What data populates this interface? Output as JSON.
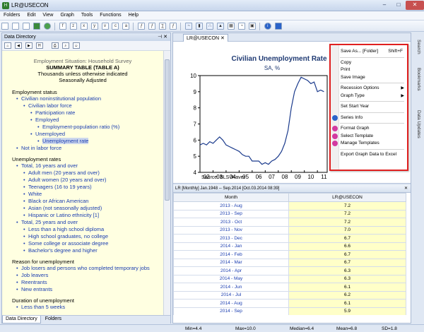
{
  "window": {
    "title": "LR@USECON"
  },
  "menu": [
    "Folders",
    "Edit",
    "View",
    "Graph",
    "Tools",
    "Functions",
    "Help"
  ],
  "left_panel": {
    "header": "Data Directory",
    "doc": {
      "subtitle": "Employment Situation: Household Survey",
      "title": "SUMMARY TABLE (TABLE A)",
      "line1": "Thousands unless otherwise indicated",
      "line2": "Seasonally Adjusted"
    },
    "sections": [
      {
        "heading": "Employment status",
        "items": [
          {
            "label": "Civilian noninstitutional population",
            "level": 1
          },
          {
            "label": "Civilian labor force",
            "level": 2
          },
          {
            "label": "Participation rate",
            "level": 3
          },
          {
            "label": "Employed",
            "level": 3
          },
          {
            "label": "Employment-population ratio (%)",
            "level": 4
          },
          {
            "label": "Unemployed",
            "level": 3
          },
          {
            "label": "Unemployment rate",
            "level": 4,
            "selected": true
          },
          {
            "label": "Not in labor force",
            "level": 1
          }
        ]
      },
      {
        "heading": "Unemployment rates",
        "items": [
          {
            "label": "Total, 16 years and over",
            "level": 1
          },
          {
            "label": "Adult men (20 years and over)",
            "level": 2
          },
          {
            "label": "Adult women (20 years and over)",
            "level": 2
          },
          {
            "label": "Teenagers (16 to 19 years)",
            "level": 2
          },
          {
            "label": "White",
            "level": 2
          },
          {
            "label": "Black or African American",
            "level": 2
          },
          {
            "label": "Asian (not seasonally adjusted)",
            "level": 2
          },
          {
            "label": "Hispanic or Latino ethnicity [1]",
            "level": 2
          },
          {
            "label": "Total, 25 years and over",
            "level": 1
          },
          {
            "label": "Less than a high school diploma",
            "level": 2
          },
          {
            "label": "High school graduates, no college",
            "level": 2
          },
          {
            "label": "Some college or associate degree",
            "level": 2
          },
          {
            "label": "Bachelor's degree and higher",
            "level": 2
          }
        ]
      },
      {
        "heading": "Reason for unemployment",
        "items": [
          {
            "label": "Job losers and persons who completed temporary jobs",
            "level": 1
          },
          {
            "label": "Job leavers",
            "level": 1
          },
          {
            "label": "Reentrants",
            "level": 1
          },
          {
            "label": "New entrants",
            "level": 1
          }
        ]
      },
      {
        "heading": "Duration of unemployment",
        "items": [
          {
            "label": "Less than 5 weeks",
            "level": 1
          }
        ]
      }
    ],
    "tabs": [
      "Data Directory",
      "Folders"
    ]
  },
  "doc_tab": {
    "label": "LR@USECON"
  },
  "chart_data": {
    "type": "line",
    "title": "Civilian Unemployment Rate",
    "subtitle": "SA, %",
    "source": "Source:  BLS /Haver",
    "ylim": [
      4,
      10
    ],
    "yticks": [
      4,
      5,
      6,
      7,
      8,
      9,
      10
    ],
    "xticks": [
      "02",
      "03",
      "04",
      "05",
      "06",
      "07",
      "08",
      "09",
      "10",
      "11"
    ],
    "x": [
      2002.0,
      2002.25,
      2002.5,
      2002.75,
      2003.0,
      2003.25,
      2003.5,
      2003.75,
      2004.0,
      2004.25,
      2004.5,
      2004.75,
      2005.0,
      2005.25,
      2005.5,
      2005.75,
      2006.0,
      2006.25,
      2006.5,
      2006.75,
      2007.0,
      2007.25,
      2007.5,
      2007.75,
      2008.0,
      2008.25,
      2008.5,
      2008.75,
      2009.0,
      2009.25,
      2009.5,
      2009.75,
      2010.0,
      2010.25,
      2010.5,
      2010.75,
      2011.0,
      2011.25,
      2011.5
    ],
    "series": [
      {
        "name": "",
        "values": [
          5.7,
          5.8,
          5.7,
          5.9,
          5.8,
          6.0,
          6.2,
          6.0,
          5.7,
          5.6,
          5.5,
          5.4,
          5.3,
          5.1,
          5.0,
          5.0,
          4.7,
          4.7,
          4.7,
          4.5,
          4.6,
          4.5,
          4.7,
          4.8,
          5.0,
          5.3,
          5.8,
          6.6,
          8.0,
          9.0,
          9.5,
          9.9,
          9.8,
          9.7,
          9.5,
          9.6,
          9.0,
          9.1,
          9.0
        ]
      }
    ]
  },
  "grid": {
    "header": "LR    [Monthly]   Jan.1948 -- Sep.2014   [Oct.03.2014 08:39]",
    "col_month": "Month",
    "col_value": "LR@USECON",
    "rows": [
      {
        "month": "2013 - Aug",
        "value": "7.2"
      },
      {
        "month": "2013 - Sep",
        "value": "7.2"
      },
      {
        "month": "2013 - Oct",
        "value": "7.2"
      },
      {
        "month": "2013 - Nov",
        "value": "7.0"
      },
      {
        "month": "2013 - Dec",
        "value": "6.7"
      },
      {
        "month": "2014 - Jan",
        "value": "6.6"
      },
      {
        "month": "2014 - Feb",
        "value": "6.7"
      },
      {
        "month": "2014 - Mar",
        "value": "6.7"
      },
      {
        "month": "2014 - Apr",
        "value": "6.3"
      },
      {
        "month": "2014 - May",
        "value": "6.3"
      },
      {
        "month": "2014 - Jun",
        "value": "6.1"
      },
      {
        "month": "2014 - Jul",
        "value": "6.2"
      },
      {
        "month": "2014 - Aug",
        "value": "6.1"
      },
      {
        "month": "2014 - Sep",
        "value": "5.9"
      }
    ]
  },
  "status": {
    "min": "Min=4.4",
    "max": "Max=10.0",
    "median": "Median=6.4",
    "mean": "Mean=6.8",
    "sd": "SD=1.8"
  },
  "side_tabs": [
    "Search",
    "Bookmarks",
    "Data Updates"
  ],
  "context_menu": [
    {
      "label": "Save As... [Folder]",
      "shortcut": "Shift+F"
    },
    {
      "sep": true
    },
    {
      "label": "Copy"
    },
    {
      "label": "Print"
    },
    {
      "label": "Save Image"
    },
    {
      "sep": true
    },
    {
      "label": "Recession Options",
      "sub": true
    },
    {
      "label": "Graph Type",
      "sub": true
    },
    {
      "sep": true
    },
    {
      "label": "Set Start Year"
    },
    {
      "sep": true
    },
    {
      "label": "Series Info",
      "icon": "#2a63c9"
    },
    {
      "sep": true
    },
    {
      "label": "Format Graph",
      "icon": "#d23aa0"
    },
    {
      "label": "Select Template",
      "icon": "#d23aa0"
    },
    {
      "label": "Manage Templates",
      "icon": "#d23aa0"
    },
    {
      "sep": true
    },
    {
      "label": "Export Graph Data to Excel"
    }
  ]
}
